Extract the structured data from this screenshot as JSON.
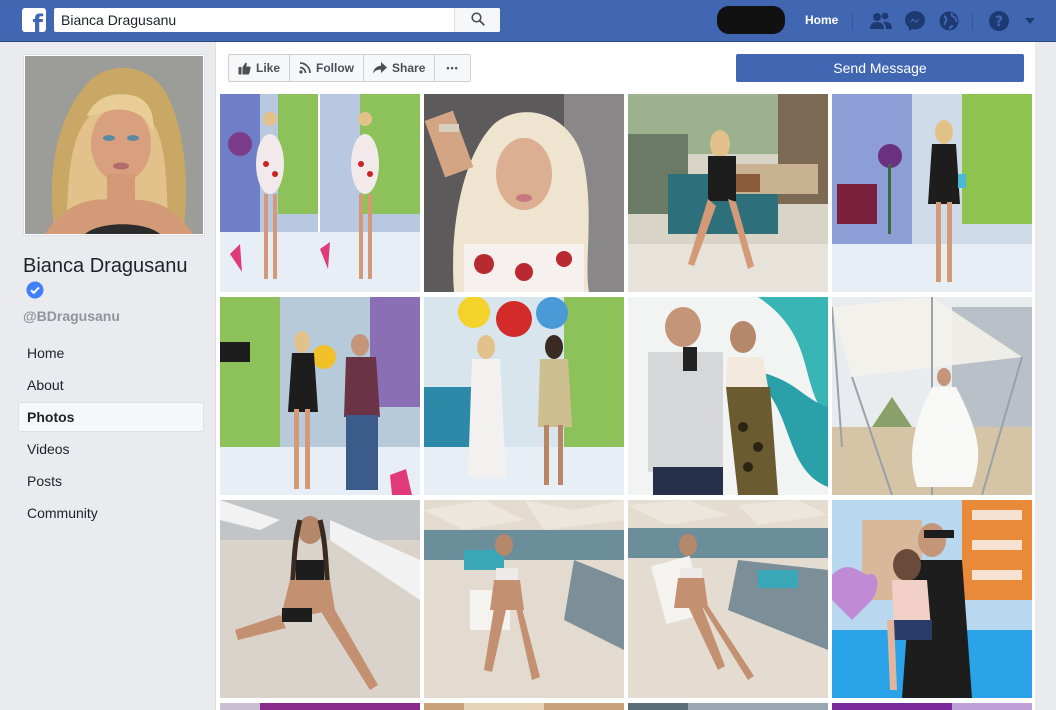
{
  "header": {
    "search_value": "Bianca Dragusanu",
    "home_label": "Home",
    "icons": [
      "facebook-logo-icon",
      "search-icon",
      "friend-requests-icon",
      "messenger-icon",
      "notifications-globe-icon",
      "help-icon",
      "account-menu-caret-icon"
    ],
    "brand_color": "#4267b2"
  },
  "profile": {
    "name": "Bianca Dragusanu",
    "username": "@BDragusanu",
    "verified_icon": "verified-badge-icon"
  },
  "sidebar": {
    "items": [
      {
        "label": "Home",
        "active": false
      },
      {
        "label": "About",
        "active": false
      },
      {
        "label": "Photos",
        "active": true
      },
      {
        "label": "Videos",
        "active": false
      },
      {
        "label": "Posts",
        "active": false
      },
      {
        "label": "Community",
        "active": false
      }
    ]
  },
  "actions": {
    "like_label": "Like",
    "follow_label": "Follow",
    "share_label": "Share",
    "more_label": "•••",
    "send_message_label": "Send Message"
  },
  "photos": {
    "items": [
      {
        "scene": "tv-studio-two-poses-floral-dress"
      },
      {
        "scene": "selfie-floral-top"
      },
      {
        "scene": "cafe-black-dress-seated"
      },
      {
        "scene": "tv-studio-black-dress"
      },
      {
        "scene": "tv-studio-with-man"
      },
      {
        "scene": "tv-studio-two-women-flowers"
      },
      {
        "scene": "mirror-selfie-with-man"
      },
      {
        "scene": "white-dress-beach-canopy"
      },
      {
        "scene": "beach-sand-black-bikini"
      },
      {
        "scene": "beach-lounger-striped-bikini"
      },
      {
        "scene": "beach-lounger-striped-bikini-2"
      },
      {
        "scene": "pool-with-child"
      }
    ]
  }
}
